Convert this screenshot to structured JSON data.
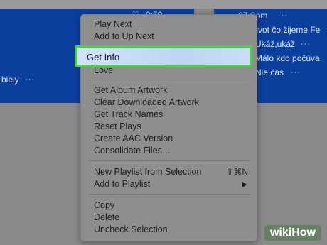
{
  "background": {
    "right_rows": [
      {
        "text": "07 Som"
      },
      {
        "text": "Život čo žijeme Fe"
      },
      {
        "text": "Ukáž,ukáž"
      },
      {
        "text": "Málo kdo počúva"
      },
      {
        "text": "Nie čas"
      }
    ],
    "left_time": "0:50",
    "left_fragment": "biely",
    "more_glyph": "···",
    "selection_color": "#0b3f9e"
  },
  "menu": {
    "group1": [
      "Play Next",
      "Add to Up Next"
    ],
    "highlighted": "Get Info",
    "group2_after": [
      "Love"
    ],
    "group3": [
      "Get Album Artwork",
      "Clear Downloaded Artwork",
      "Get Track Names",
      "Reset Plays",
      "Create AAC Version",
      "Consolidate Files…"
    ],
    "group4": [
      {
        "label": "New Playlist from Selection",
        "shortcut": "⇧⌘N"
      },
      {
        "label": "Add to Playlist",
        "submenu": true
      }
    ],
    "group5": [
      "Copy",
      "Delete",
      "Uncheck Selection"
    ],
    "highlight_border_color": "#3fd63f"
  },
  "watermark": {
    "text": "wikiHow"
  }
}
